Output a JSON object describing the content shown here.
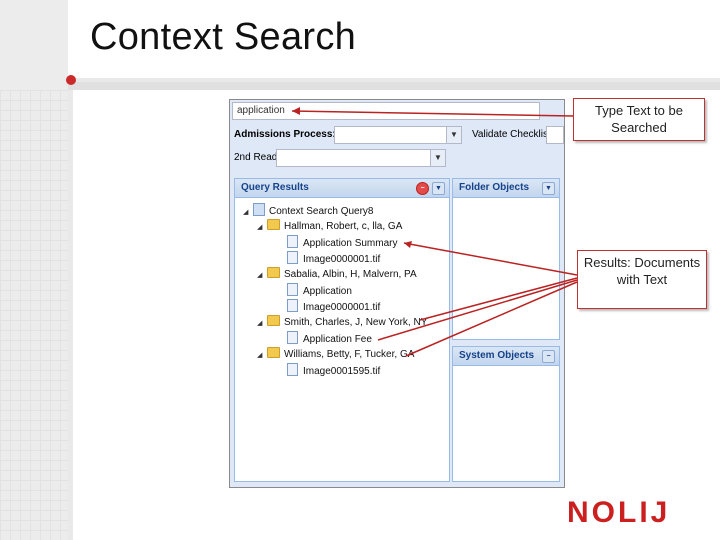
{
  "slide": {
    "title": "Context Search",
    "logo": "NOLIJ"
  },
  "app": {
    "search": {
      "value": "application"
    },
    "admissions_label": "Admissions Process:",
    "admissions_value": "",
    "validate_label": "Validate Checklist",
    "second_read_label": "2nd Read",
    "second_read_value": "",
    "query_panel": {
      "title": "Query Results",
      "root": "Context Search Query8",
      "folders": [
        {
          "label": "Hallman, Robert, c, lla, GA",
          "docs": [
            "Application Summary",
            "Image0000001.tif"
          ]
        },
        {
          "label": "Sabalia, Albin, H, Malvern, PA",
          "docs": [
            "Application",
            "Image0000001.tif"
          ]
        },
        {
          "label": "Smith, Charles, J, New York, NY",
          "docs": [
            "Application Fee"
          ]
        },
        {
          "label": "Williams, Betty, F, Tucker, GA",
          "docs": [
            "Image0001595.tif"
          ]
        }
      ]
    },
    "folder_panel": {
      "title": "Folder Objects"
    },
    "system_panel": {
      "title": "System Objects"
    }
  },
  "callouts": {
    "type_text": "Type Text to be Searched",
    "results": "Results: Documents with Text"
  },
  "colors": {
    "accent": "#cc1f1f",
    "panel_header": "#15428b"
  }
}
